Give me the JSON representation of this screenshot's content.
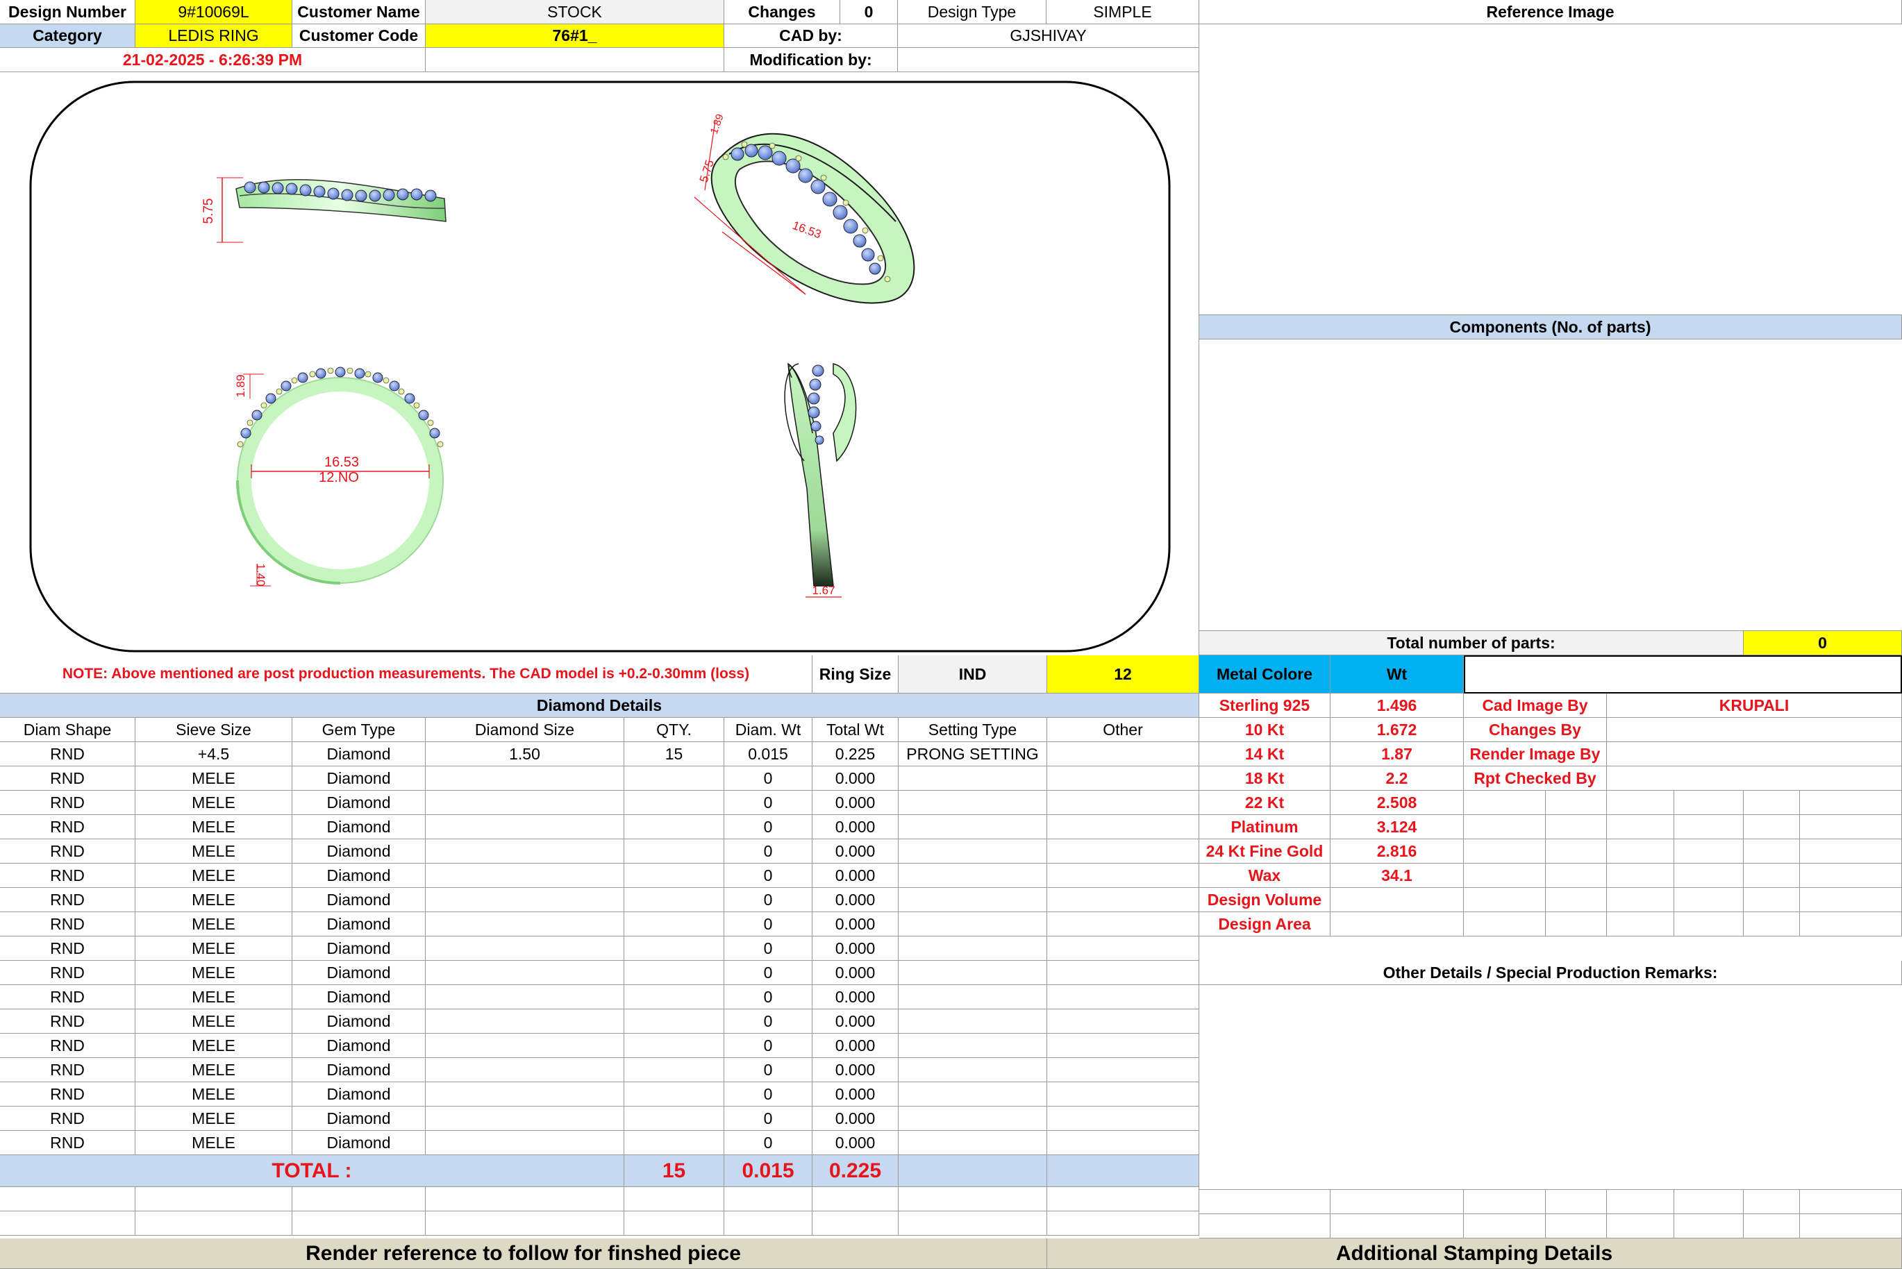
{
  "header": {
    "design_number_label": "Design Number",
    "design_number": "9#10069L",
    "customer_name_label": "Customer Name",
    "customer_name": "STOCK",
    "changes_label": "Changes",
    "changes": "0",
    "design_type_label": "Design Type",
    "design_type": "SIMPLE",
    "category_label": "Category",
    "category": "LEDIS RING",
    "customer_code_label": "Customer Code",
    "customer_code": "76#1_",
    "cad_by_label": "CAD by:",
    "cad_by": "GJSHIVAY",
    "datetime": "21-02-2025 - 6:26:39 PM",
    "modification_label": "Modification by:",
    "modification": ""
  },
  "drawing": {
    "dim_height_side": "5.75",
    "dim_height_persp": "5.75",
    "dim_inner_persp": "16.53",
    "dim_top_persp": "1.89",
    "dim_top_front": "1.89",
    "dim_inner_front": "16.53",
    "ring_no_front": "12.NO",
    "dim_bottom_front": "1.40",
    "dim_bottom_side": "1.67"
  },
  "right_panel": {
    "reference_image_title": "Reference Image",
    "components_title": "Components (No. of parts)",
    "total_parts_label": "Total number of parts:",
    "total_parts": "0"
  },
  "note": "NOTE: Above mentioned are post production measurements. The CAD model is +0.2-0.30mm (loss)",
  "ring_size": {
    "label": "Ring Size",
    "standard": "IND",
    "value": "12"
  },
  "metal": {
    "header_label": "Metal Colore",
    "header_wt": "Wt",
    "rows": [
      {
        "name": "Sterling 925",
        "wt": "1.496"
      },
      {
        "name": "10 Kt",
        "wt": "1.672"
      },
      {
        "name": "14 Kt",
        "wt": "1.87"
      },
      {
        "name": "18 Kt",
        "wt": "2.2"
      },
      {
        "name": "22 Kt",
        "wt": "2.508"
      },
      {
        "name": "Platinum",
        "wt": "3.124"
      },
      {
        "name": "24 Kt Fine Gold",
        "wt": "2.816"
      },
      {
        "name": "Wax",
        "wt": "34.1"
      },
      {
        "name": "Design Volume",
        "wt": ""
      },
      {
        "name": "Design Area",
        "wt": ""
      }
    ]
  },
  "credits": [
    {
      "label": "Cad Image By",
      "value": "KRUPALI"
    },
    {
      "label": "Changes By",
      "value": ""
    },
    {
      "label": "Render Image By",
      "value": ""
    },
    {
      "label": "Rpt Checked By",
      "value": ""
    }
  ],
  "other_details_title": "Other Details / Special Production Remarks:",
  "diamond": {
    "title": "Diamond Details",
    "columns": [
      "Diam Shape",
      "Sieve Size",
      "Gem Type",
      "Diamond Size",
      "QTY.",
      "Diam. Wt",
      "Total Wt",
      "Setting Type",
      "Other"
    ],
    "rows": [
      [
        "RND",
        "+4.5",
        "Diamond",
        "1.50",
        "15",
        "0.015",
        "0.225",
        "PRONG SETTING",
        ""
      ],
      [
        "RND",
        "MELE",
        "Diamond",
        "",
        "",
        "0",
        "0.000",
        "",
        ""
      ],
      [
        "RND",
        "MELE",
        "Diamond",
        "",
        "",
        "0",
        "0.000",
        "",
        ""
      ],
      [
        "RND",
        "MELE",
        "Diamond",
        "",
        "",
        "0",
        "0.000",
        "",
        ""
      ],
      [
        "RND",
        "MELE",
        "Diamond",
        "",
        "",
        "0",
        "0.000",
        "",
        ""
      ],
      [
        "RND",
        "MELE",
        "Diamond",
        "",
        "",
        "0",
        "0.000",
        "",
        ""
      ],
      [
        "RND",
        "MELE",
        "Diamond",
        "",
        "",
        "0",
        "0.000",
        "",
        ""
      ],
      [
        "RND",
        "MELE",
        "Diamond",
        "",
        "",
        "0",
        "0.000",
        "",
        ""
      ],
      [
        "RND",
        "MELE",
        "Diamond",
        "",
        "",
        "0",
        "0.000",
        "",
        ""
      ],
      [
        "RND",
        "MELE",
        "Diamond",
        "",
        "",
        "0",
        "0.000",
        "",
        ""
      ],
      [
        "RND",
        "MELE",
        "Diamond",
        "",
        "",
        "0",
        "0.000",
        "",
        ""
      ],
      [
        "RND",
        "MELE",
        "Diamond",
        "",
        "",
        "0",
        "0.000",
        "",
        ""
      ],
      [
        "RND",
        "MELE",
        "Diamond",
        "",
        "",
        "0",
        "0.000",
        "",
        ""
      ],
      [
        "RND",
        "MELE",
        "Diamond",
        "",
        "",
        "0",
        "0.000",
        "",
        ""
      ],
      [
        "RND",
        "MELE",
        "Diamond",
        "",
        "",
        "0",
        "0.000",
        "",
        ""
      ],
      [
        "RND",
        "MELE",
        "Diamond",
        "",
        "",
        "0",
        "0.000",
        "",
        ""
      ],
      [
        "RND",
        "MELE",
        "Diamond",
        "",
        "",
        "0",
        "0.000",
        "",
        ""
      ]
    ],
    "total_label": "TOTAL :",
    "total_qty": "15",
    "total_diam_wt": "0.015",
    "total_wt": "0.225"
  },
  "footer": {
    "render_reference": "Render reference to follow for finshed piece",
    "stamping": "Additional Stamping Details"
  },
  "colors": {
    "highlight_yellow": "#ffff00",
    "header_blue": "#c5d9f1",
    "metal_cyan": "#00b0f0",
    "label_red": "#e8141b",
    "ring_green": "#c6f5bf",
    "stone_blue": "#6f8fd6"
  }
}
